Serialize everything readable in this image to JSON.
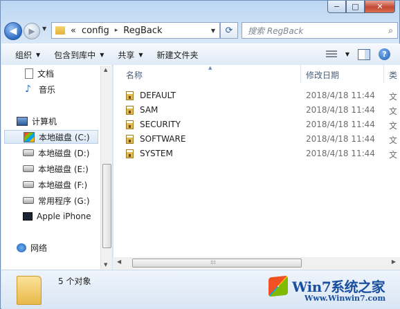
{
  "window": {
    "controls": {
      "minimize": "−",
      "maximize": "□",
      "close": "✕"
    }
  },
  "nav": {
    "back_icon": "◀",
    "forward_icon": "▶",
    "breadcrumb": {
      "overflow": "«",
      "items": [
        "config",
        "RegBack"
      ],
      "separator": "▸"
    },
    "refresh_icon": "⟳",
    "search_placeholder": "搜索 RegBack",
    "search_icon": "⌕"
  },
  "toolbar": {
    "organize": "组织",
    "include_in_library": "包含到库中",
    "share": "共享",
    "new_folder": "新建文件夹",
    "help": "?"
  },
  "sidebar": {
    "items": [
      {
        "label": "文档",
        "icon": "document-icon"
      },
      {
        "label": "音乐",
        "icon": "music-icon"
      },
      {
        "label": "计算机",
        "icon": "computer-icon"
      },
      {
        "label": "本地磁盘 (C:)",
        "icon": "system-drive-icon",
        "selected": true
      },
      {
        "label": "本地磁盘 (D:)",
        "icon": "drive-icon"
      },
      {
        "label": "本地磁盘 (E:)",
        "icon": "drive-icon"
      },
      {
        "label": "本地磁盘 (F:)",
        "icon": "drive-icon"
      },
      {
        "label": "常用程序 (G:)",
        "icon": "drive-icon"
      },
      {
        "label": "Apple iPhone",
        "icon": "phone-icon"
      },
      {
        "label": "网络",
        "icon": "network-icon"
      }
    ]
  },
  "columns": {
    "name": "名称",
    "modified": "修改日期",
    "type": "类"
  },
  "files": [
    {
      "name": "DEFAULT",
      "modified": "2018/4/18 11:44",
      "type": "文"
    },
    {
      "name": "SAM",
      "modified": "2018/4/18 11:44",
      "type": "文"
    },
    {
      "name": "SECURITY",
      "modified": "2018/4/18 11:44",
      "type": "文"
    },
    {
      "name": "SOFTWARE",
      "modified": "2018/4/18 11:44",
      "type": "文"
    },
    {
      "name": "SYSTEM",
      "modified": "2018/4/18 11:44",
      "type": "文"
    }
  ],
  "status": {
    "item_count": "5 个对象"
  },
  "watermark": {
    "brand": "Win7系统之家",
    "url": "Www.Winwin7.com"
  }
}
